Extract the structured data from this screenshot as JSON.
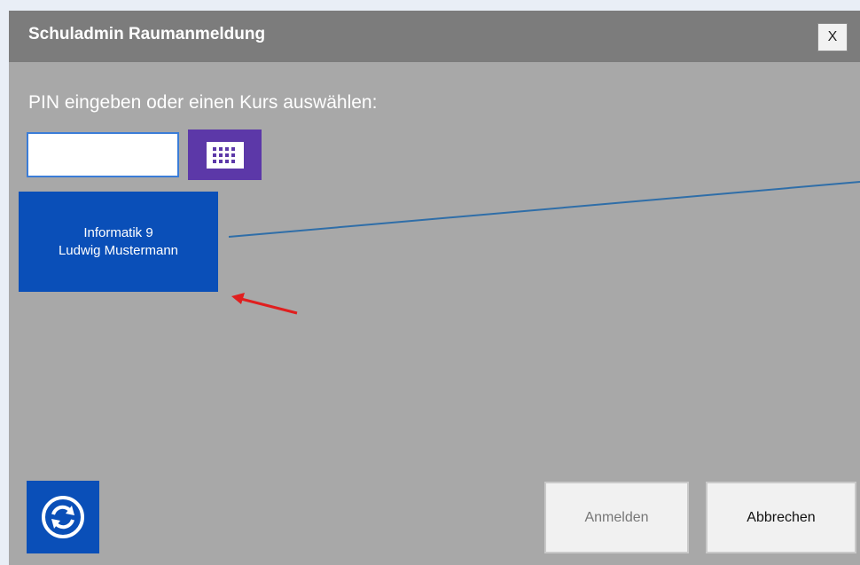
{
  "window": {
    "title": "Schuladmin Raumanmeldung",
    "close_label": "X"
  },
  "prompt": "PIN eingeben oder einen Kurs auswählen:",
  "pin_input": {
    "value": ""
  },
  "keypad": {
    "icon": "keypad-icon"
  },
  "course": {
    "name": "Informatik 9",
    "teacher": "Ludwig Mustermann"
  },
  "refresh": {
    "icon": "refresh-icon"
  },
  "buttons": {
    "login_label": "Anmelden",
    "cancel_label": "Abbrechen"
  },
  "colors": {
    "tile_blue": "#0a4fb8",
    "keypad_purple": "#5c38a8",
    "dialog_gray": "#a8a8a8",
    "title_gray": "#7c7c7c",
    "annotation_red": "#e01f1f",
    "annotation_line": "#2f6ea8"
  }
}
